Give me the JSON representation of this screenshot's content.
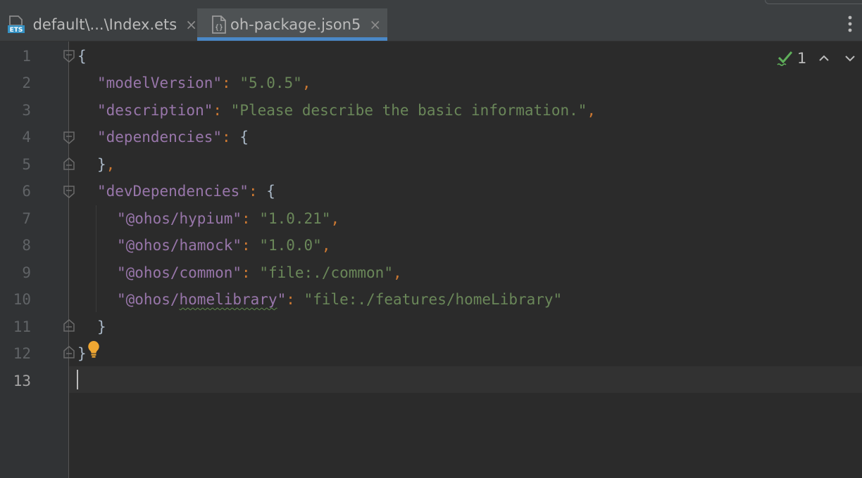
{
  "tabs": [
    {
      "label": "default\\...\\Index.ets",
      "icon": "ets-file-icon",
      "active": false,
      "close": "×"
    },
    {
      "label": "oh-package.json5",
      "icon": "json-file-icon",
      "active": true,
      "close": "×"
    }
  ],
  "colors": {
    "accent": "#4a88c7",
    "key": "#9876aa",
    "string": "#6a8759",
    "punctuation": "#cc7832",
    "text": "#a9b7c6",
    "background": "#2b2b2b"
  },
  "inspections": {
    "count": "1",
    "icon": "check-icon"
  },
  "line_numbers": [
    "1",
    "2",
    "3",
    "4",
    "5",
    "6",
    "7",
    "8",
    "9",
    "10",
    "11",
    "12",
    "13"
  ],
  "current_line": "13",
  "code": {
    "l1": {
      "brace": "{"
    },
    "l2": {
      "key": "\"modelVersion\"",
      "colon": ": ",
      "value": "\"5.0.5\"",
      "comma": ","
    },
    "l3": {
      "key": "\"description\"",
      "colon": ": ",
      "value": "\"Please describe the basic information.\"",
      "comma": ","
    },
    "l4": {
      "key": "\"dependencies\"",
      "colon": ": ",
      "brace": "{"
    },
    "l5": {
      "brace": "}",
      "comma": ","
    },
    "l6": {
      "key": "\"devDependencies\"",
      "colon": ": ",
      "brace": "{"
    },
    "l7": {
      "key": "\"@ohos/hypium\"",
      "colon": ": ",
      "value": "\"1.0.21\"",
      "comma": ","
    },
    "l8": {
      "key": "\"@ohos/hamock\"",
      "colon": ": ",
      "value": "\"1.0.0\"",
      "comma": ","
    },
    "l9": {
      "key": "\"@ohos/common\"",
      "colon": ": ",
      "value": "\"file:./common\"",
      "comma": ","
    },
    "l10": {
      "key_a": "\"@ohos/",
      "key_b": "homelibrary",
      "key_c": "\"",
      "colon": ": ",
      "value": "\"file:./features/homeLibrary\""
    },
    "l11": {
      "brace": "}"
    },
    "l12": {
      "brace": "}"
    }
  }
}
